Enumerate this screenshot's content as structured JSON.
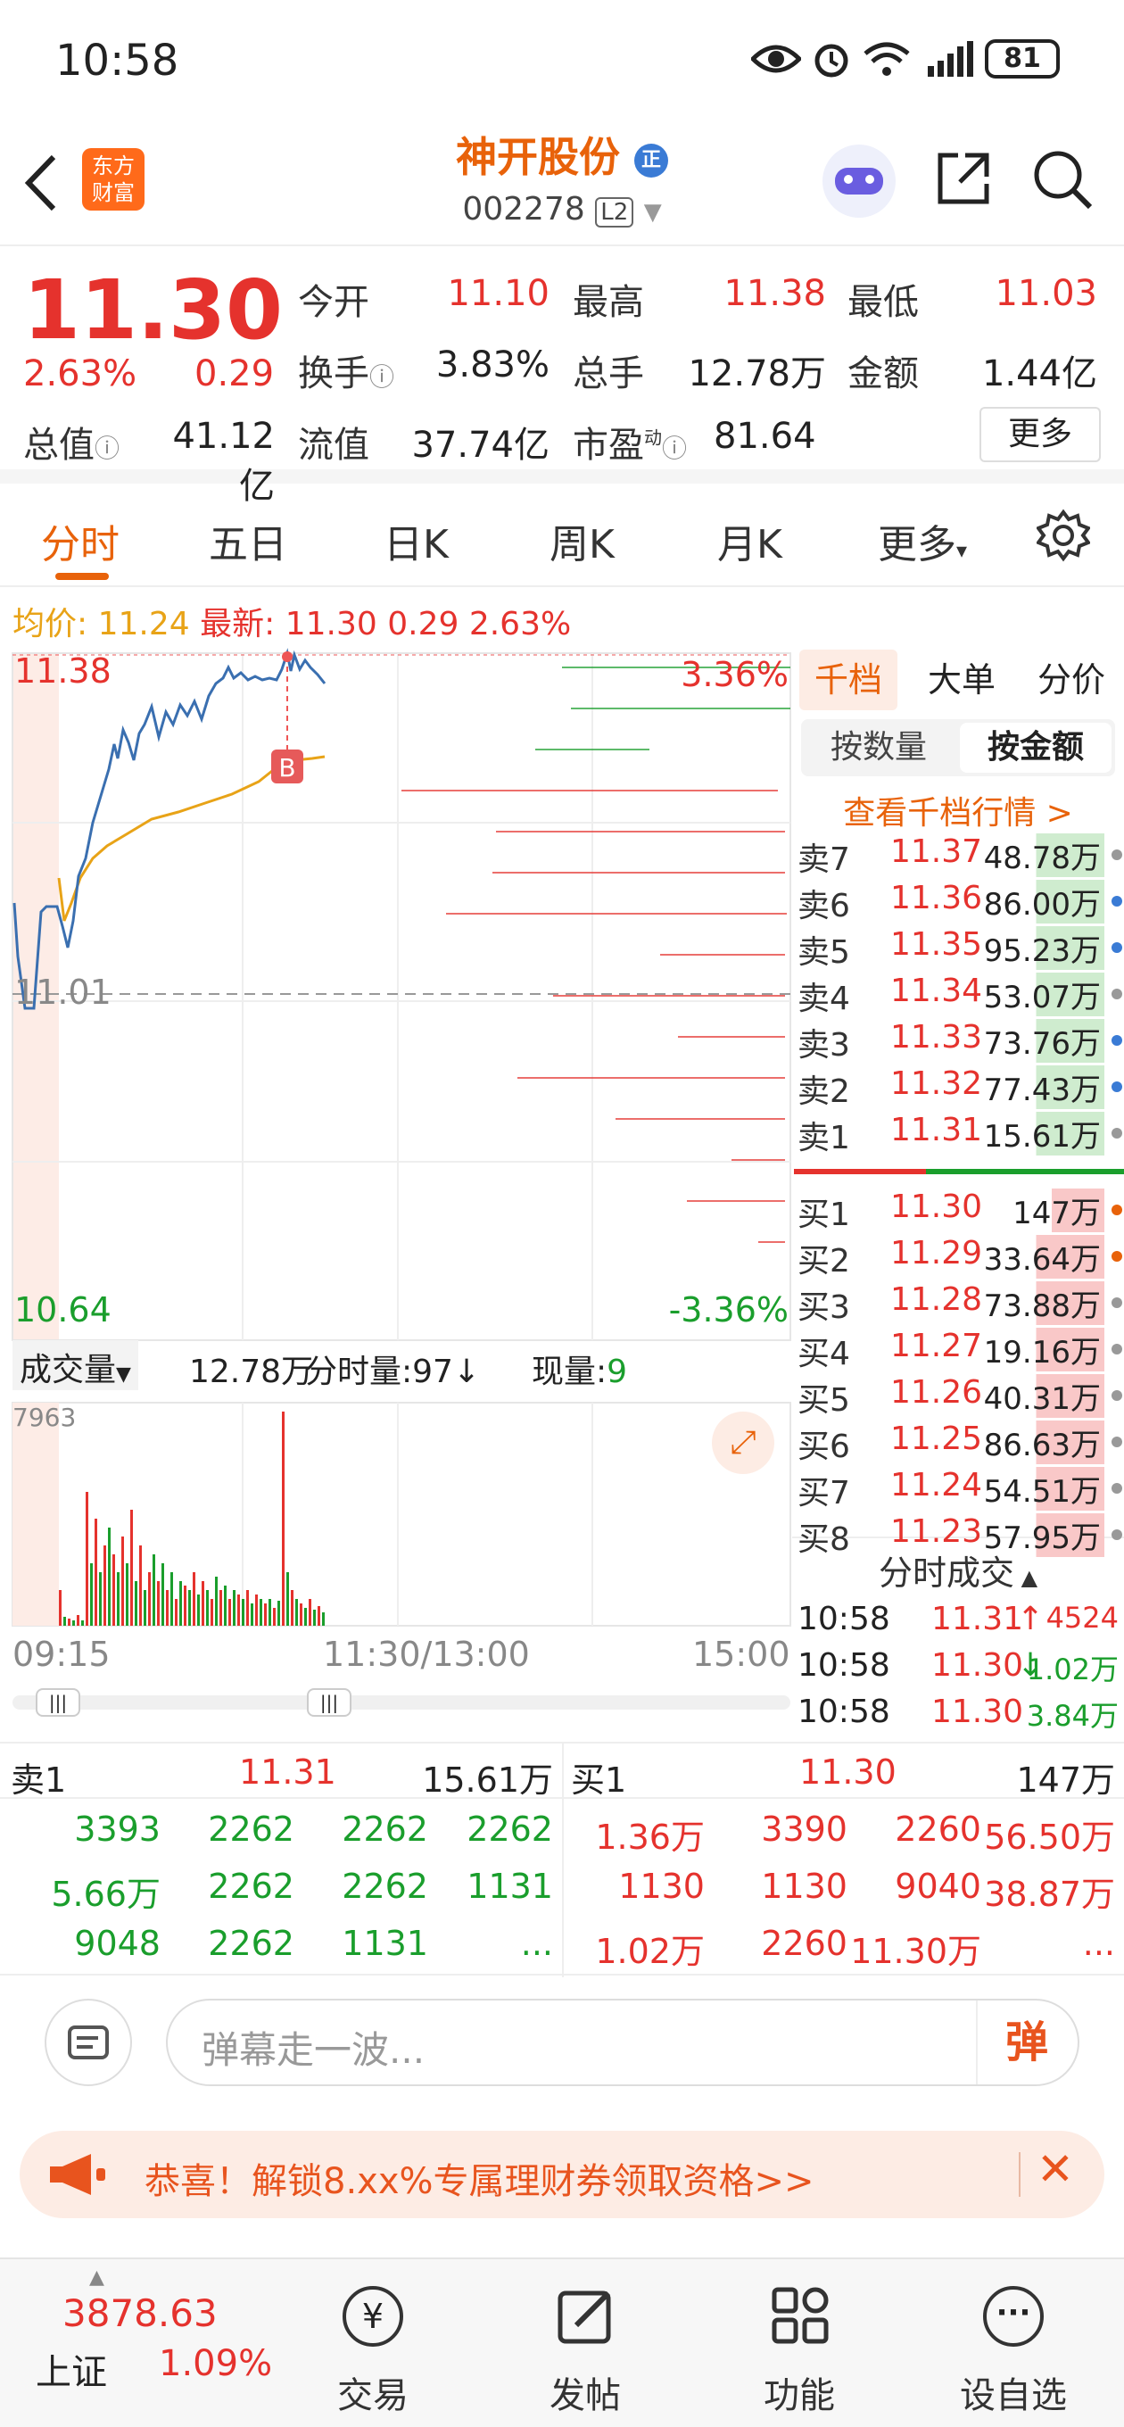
{
  "status": {
    "time": "10:58",
    "battery": "81"
  },
  "header": {
    "brand_line1": "东方",
    "brand_line2": "财富",
    "stock_name": "神开股份",
    "stock_badge": "正",
    "stock_code": "002278",
    "level_badge": "L2"
  },
  "quote": {
    "price": "11.30",
    "change_pct": "2.63%",
    "change_abs": "0.29",
    "open_label": "今开",
    "open": "11.10",
    "high_label": "最高",
    "high": "11.38",
    "low_label": "最低",
    "low": "11.03",
    "turnover_label": "换手",
    "turnover": "3.83%",
    "volume_label": "总手",
    "volume": "12.78万",
    "amount_label": "金额",
    "amount": "1.44亿",
    "mktcap_label": "总值",
    "mktcap": "41.12亿",
    "float_label": "流值",
    "float": "37.74亿",
    "pe_label": "市盈",
    "pe_sup": "动",
    "pe": "81.64",
    "more_label": "更多"
  },
  "tabs": [
    "分时",
    "五日",
    "日K",
    "周K",
    "月K",
    "更多"
  ],
  "info_line": {
    "avg_label": "均价:",
    "avg": "11.24",
    "latest_label": "最新:",
    "latest": "11.30",
    "chg": "0.29",
    "pct": "2.63%"
  },
  "chart": {
    "y_top": "11.38",
    "y_mid": "11.01",
    "y_bottom": "10.64",
    "pct_top": "3.36%",
    "pct_bottom": "-3.36%",
    "marker": "B",
    "vol_label": "成交量",
    "vol_total": "12.78万",
    "vol_period_label": "分时量:",
    "vol_period": "97",
    "vol_now_label": "现量:",
    "vol_now": "9",
    "vol_max": "7963",
    "x_start": "09:15",
    "x_mid": "11:30/13:00",
    "x_end": "15:00"
  },
  "book": {
    "tabs": [
      "千档",
      "大单",
      "分价"
    ],
    "toggle": [
      "按数量",
      "按金额"
    ],
    "view_link": "查看千档行情 >",
    "asks": [
      {
        "label": "卖7",
        "price": "11.37",
        "vol": "48.78万",
        "dot": "#999"
      },
      {
        "label": "卖6",
        "price": "11.36",
        "vol": "86.00万",
        "dot": "#3a7bd5"
      },
      {
        "label": "卖5",
        "price": "11.35",
        "vol": "95.23万",
        "dot": "#3a7bd5"
      },
      {
        "label": "卖4",
        "price": "11.34",
        "vol": "53.07万",
        "dot": "#999"
      },
      {
        "label": "卖3",
        "price": "11.33",
        "vol": "73.76万",
        "dot": "#3a7bd5"
      },
      {
        "label": "卖2",
        "price": "11.32",
        "vol": "77.43万",
        "dot": "#3a7bd5"
      },
      {
        "label": "卖1",
        "price": "11.31",
        "vol": "15.61万",
        "dot": "#999"
      }
    ],
    "bids": [
      {
        "label": "买1",
        "price": "11.30",
        "vol": "147万",
        "dot": "#e8620a"
      },
      {
        "label": "买2",
        "price": "11.29",
        "vol": "33.64万",
        "dot": "#e8620a"
      },
      {
        "label": "买3",
        "price": "11.28",
        "vol": "73.88万",
        "dot": "#999"
      },
      {
        "label": "买4",
        "price": "11.27",
        "vol": "19.16万",
        "dot": "#999"
      },
      {
        "label": "买5",
        "price": "11.26",
        "vol": "40.31万",
        "dot": "#999"
      },
      {
        "label": "买6",
        "price": "11.25",
        "vol": "86.63万",
        "dot": "#999"
      },
      {
        "label": "买7",
        "price": "11.24",
        "vol": "54.51万",
        "dot": "#999"
      },
      {
        "label": "买8",
        "price": "11.23",
        "vol": "57.95万",
        "dot": "#999"
      }
    ],
    "ticks_title": "分时成交",
    "ticks": [
      {
        "time": "10:58",
        "price": "11.31",
        "arrow": "↑",
        "vol": "4524"
      },
      {
        "time": "10:58",
        "price": "11.30",
        "arrow": "↓",
        "vol": "1.02万"
      },
      {
        "time": "10:58",
        "price": "11.30",
        "arrow": "",
        "vol": "3.84万"
      }
    ]
  },
  "queue": {
    "sell_label": "卖1",
    "sell_price": "11.31",
    "sell_vol": "15.61万",
    "buy_label": "买1",
    "buy_price": "11.30",
    "buy_vol": "147万",
    "sell_rows": [
      [
        "3393",
        "2262",
        "2262",
        "2262"
      ],
      [
        "5.66万",
        "2262",
        "2262",
        "1131"
      ],
      [
        "9048",
        "2262",
        "1131",
        "..."
      ]
    ],
    "buy_rows": [
      [
        "1.36万",
        "3390",
        "2260",
        "56.50万"
      ],
      [
        "1130",
        "1130",
        "9040",
        "38.87万"
      ],
      [
        "1.02万",
        "2260",
        "11.30万",
        "..."
      ]
    ]
  },
  "danmu": {
    "placeholder": "弹幕走一波...",
    "button": "弹"
  },
  "banner": {
    "text": "恭喜！解锁8.xx%专属理财券领取资格>>"
  },
  "nav": {
    "index_value": "3878.63",
    "index_name": "上证",
    "index_pct": "1.09%",
    "items": [
      "交易",
      "发帖",
      "功能",
      "设自选"
    ]
  }
}
